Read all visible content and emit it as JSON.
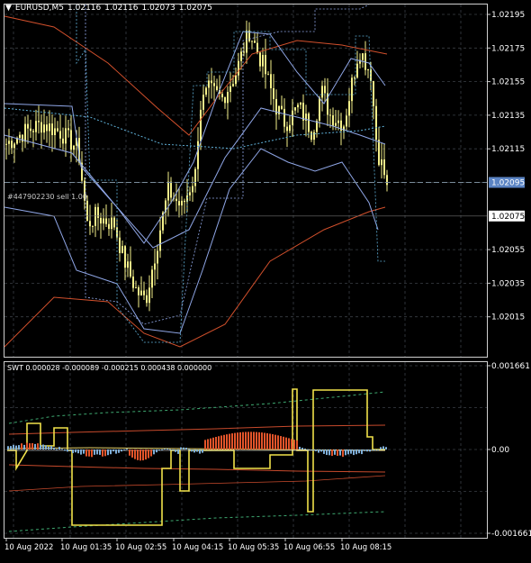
{
  "colors": {
    "background": "#000000",
    "grid": "#3a3f46",
    "axis_text": "#ffffff",
    "candle": "#f4f08a",
    "band_blue": "#8fa6e6",
    "band_red": "#d2502c",
    "band_cyan": "#5fb0d8",
    "order_line": "#7a8c9a",
    "price_label_bg": "#5b84c4",
    "swt_yellow": "#f1e24a",
    "swt_orange": "#e2542a",
    "swt_blue": "#7eaed8",
    "swt_red_line": "#c74a2c",
    "swt_green_dash": "#3ea870"
  },
  "header": {
    "symbol_tf": "EURUSD,M5",
    "open": "1.02116",
    "high": "1.02116",
    "low": "1.02073",
    "close": "1.02075"
  },
  "order_line_label": "#447902230 sell 1.00",
  "price_axis": {
    "ticks": [
      "1.02195",
      "1.02175",
      "1.02155",
      "1.02135",
      "1.02115",
      "1.02055",
      "1.02035",
      "1.02015"
    ],
    "current_price": "1.02075",
    "order_price": "1.02095"
  },
  "indicator": {
    "label": "SWT 0.000028 -0.000089 -0.000215 0.000438 0.000000",
    "ticks": [
      "0.001661",
      "0.00",
      "-0.001661"
    ]
  },
  "time_axis": {
    "labels": [
      "10 Aug 2022",
      "10 Aug 01:35",
      "10 Aug 02:55",
      "10 Aug 04:15",
      "10 Aug 05:35",
      "10 Aug 06:55",
      "10 Aug 08:15"
    ]
  }
}
